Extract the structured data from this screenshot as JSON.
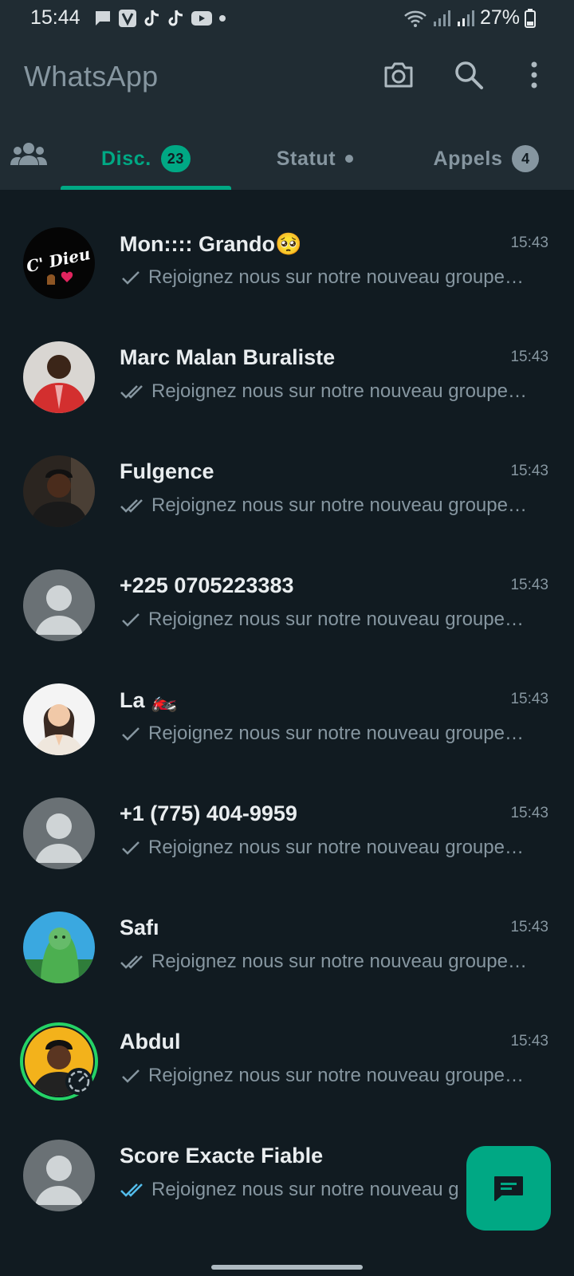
{
  "status_bar": {
    "time": "15:44",
    "battery": "27%",
    "notification_icons": [
      "message-icon",
      "v-app-icon",
      "tiktok-icon",
      "tiktok-icon",
      "youtube-icon",
      "dot-icon"
    ]
  },
  "header": {
    "title": "WhatsApp",
    "icons": [
      "camera-icon",
      "search-icon",
      "more-vert-icon"
    ]
  },
  "tabs": {
    "community_icon": "community-icon",
    "disc": {
      "label": "Disc.",
      "badge": "23",
      "selected": true
    },
    "statut": {
      "label": "Statut"
    },
    "appels": {
      "label": "Appels",
      "badge": "4"
    }
  },
  "colors": {
    "accent": "#00a884",
    "background": "#111b21",
    "header": "#202c33",
    "muted": "#8696a0",
    "read_tick": "#53bdeb"
  },
  "chats": [
    {
      "name": "Mon:::: Grando🥺",
      "time": "15:43",
      "preview": "Rejoignez nous sur notre nouveau groupe…",
      "tick": "single",
      "avatar": "cdieu"
    },
    {
      "name": "Marc Malan Buraliste",
      "time": "15:43",
      "preview": "Rejoignez nous sur notre nouveau groupe…",
      "tick": "double",
      "avatar": "photo-red"
    },
    {
      "name": "Fulgence",
      "time": "15:43",
      "preview": "Rejoignez nous sur notre nouveau groupe…",
      "tick": "double",
      "avatar": "photo-dark"
    },
    {
      "name": "+225 0705223383",
      "time": "15:43",
      "preview": "Rejoignez nous sur notre nouveau groupe…",
      "tick": "single",
      "avatar": "default"
    },
    {
      "name": "La 🏍️",
      "time": "15:43",
      "preview": "Rejoignez nous sur notre nouveau groupe…",
      "tick": "single",
      "avatar": "photo-woman"
    },
    {
      "name": "+1 (775) 404-9959",
      "time": "15:43",
      "preview": "Rejoignez nous sur notre nouveau groupe…",
      "tick": "single",
      "avatar": "default"
    },
    {
      "name": "Safı",
      "time": "15:43",
      "preview": "Rejoignez nous sur notre nouveau groupe…",
      "tick": "double",
      "avatar": "photo-green"
    },
    {
      "name": "Abdul",
      "time": "15:43",
      "preview": "Rejoignez nous sur notre nouveau groupe…",
      "tick": "single",
      "avatar": "photo-yellow-status"
    },
    {
      "name": "Score Exacte Fiable",
      "time": "",
      "preview": "Rejoignez nous sur notre nouveau g",
      "tick": "double-read",
      "avatar": "default"
    }
  ],
  "fab": {
    "icon": "new-chat-icon"
  }
}
